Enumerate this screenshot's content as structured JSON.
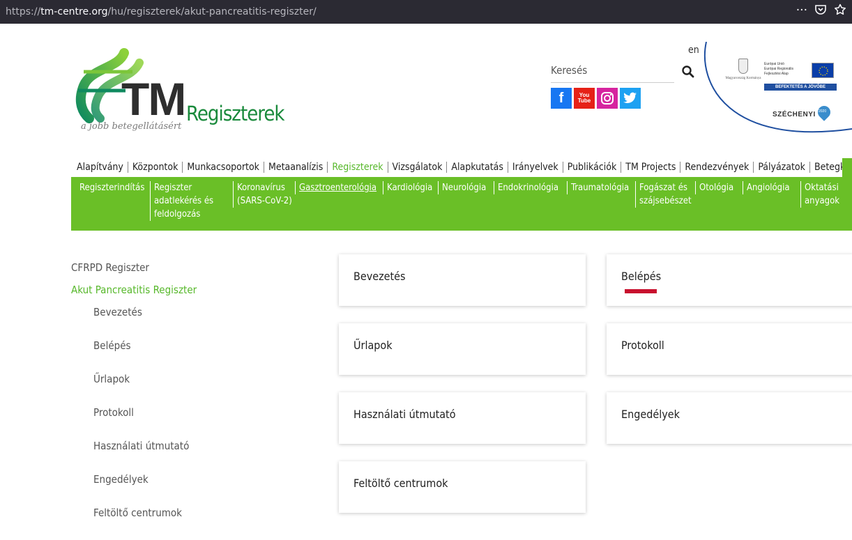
{
  "browser": {
    "url_prefix": "https://",
    "url_host": "tm-centre.org",
    "url_path": "/hu/regiszterek/akut-pancreatitis-regiszter/",
    "actions": [
      "···",
      "☐",
      "☆"
    ]
  },
  "header": {
    "logo_tm": "TM",
    "logo_regiszterek": "Regiszterek",
    "logo_tagline": "a jobb betegellátásért",
    "lang": "en",
    "search_label": "Keresés",
    "social": [
      {
        "name": "facebook",
        "label": "f",
        "color": "#1877f2"
      },
      {
        "name": "youtube",
        "label": "You Tube",
        "color": "#e62117"
      },
      {
        "name": "instagram",
        "label": "◎",
        "color": "#d6249f"
      },
      {
        "name": "twitter",
        "label": "🐦",
        "color": "#1da1f2"
      }
    ],
    "eu_badge": {
      "gov_text": "Magyarország Kormánya",
      "eu_text_1": "Európai Unió",
      "eu_text_2": "Európai Regionális",
      "eu_text_3": "Fejlesztési Alap",
      "invest_text": "BEFEKTETÉS A JÖVŐBE",
      "szechenyi": "SZÉCHENYI",
      "szechenyi_year": "2020"
    }
  },
  "main_nav": [
    {
      "label": "Alapítvány",
      "active": false
    },
    {
      "label": "Központok",
      "active": false
    },
    {
      "label": "Munkacsoportok",
      "active": false
    },
    {
      "label": "Metaanalízis",
      "active": false
    },
    {
      "label": "Regiszterek",
      "active": true
    },
    {
      "label": "Vizsgálatok",
      "active": false
    },
    {
      "label": "Alapkutatás",
      "active": false
    },
    {
      "label": "Irányelvek",
      "active": false
    },
    {
      "label": "Publikációk",
      "active": false
    },
    {
      "label": "TM Projects",
      "active": false
    },
    {
      "label": "Rendezvények",
      "active": false
    },
    {
      "label": "Pályázatok",
      "active": false
    },
    {
      "label": "Betegklub",
      "active": false
    }
  ],
  "sub_nav": [
    {
      "label": "Regiszterindítás",
      "active": false
    },
    {
      "label": "Regiszter adatlekérés és feldolgozás",
      "active": false
    },
    {
      "label": "Koronavírus (SARS-CoV-2)",
      "active": false
    },
    {
      "label": "Gasztroenterológia",
      "active": true
    },
    {
      "label": "Kardiológia",
      "active": false
    },
    {
      "label": "Neurológia",
      "active": false
    },
    {
      "label": "Endokrinológia",
      "active": false
    },
    {
      "label": "Traumatológia",
      "active": false
    },
    {
      "label": "Fogászat és szájsebészet",
      "active": false
    },
    {
      "label": "Otológia",
      "active": false
    },
    {
      "label": "Angiológia",
      "active": false
    },
    {
      "label": "Oktatási anyagok",
      "active": false
    }
  ],
  "sidebar": {
    "parents": [
      {
        "label": "CFRPD Regiszter",
        "active": false
      },
      {
        "label": "Akut Pancreatitis Regiszter",
        "active": true
      }
    ],
    "children": [
      "Bevezetés",
      "Belépés",
      "Űrlapok",
      "Protokoll",
      "Használati útmutató",
      "Engedélyek",
      "Feltöltő centrumok"
    ]
  },
  "cards": [
    {
      "label": "Bevezetés",
      "highlight": false
    },
    {
      "label": "Belépés",
      "highlight": true
    },
    {
      "label": "Űrlapok",
      "highlight": false
    },
    {
      "label": "Protokoll",
      "highlight": false
    },
    {
      "label": "Használati útmutató",
      "highlight": false
    },
    {
      "label": "Engedélyek",
      "highlight": false
    },
    {
      "label": "Feltöltő centrumok",
      "highlight": false
    }
  ],
  "colors": {
    "accent_green": "#6abf27",
    "active_green": "#57b82b",
    "card_bar": "#c8102e",
    "browser_bar": "#2b2a33"
  }
}
